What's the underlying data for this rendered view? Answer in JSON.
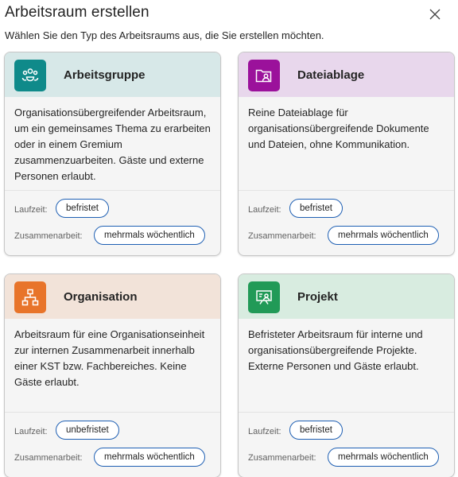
{
  "dialog": {
    "title": "Arbeitsraum erstellen",
    "subtitle": "Wählen Sie den Typ des Arbeitsraums aus, die Sie erstellen möchten."
  },
  "labels": {
    "laufzeit": "Laufzeit:",
    "zusammenarbeit": "Zusammenarbeit:"
  },
  "cards": [
    {
      "title": "Arbeitsgruppe",
      "description": "Organisationsübergreifender Arbeitsraum, um ein gemeinsames Thema zu erarbeiten oder in einem Gremium zusammenzuarbeiten. Gäste und externe Personen erlaubt.",
      "laufzeit": "befristet",
      "zusammenarbeit": "mehrmals wöchentlich",
      "icon": "people-group-icon",
      "header_color": "#d7e8e8",
      "icon_color": "#0f8a8a"
    },
    {
      "title": "Dateiablage",
      "description": "Reine Dateiablage für organisationsübergreifende Dokumente und Dateien, ohne Kommunikation.",
      "laufzeit": "befristet",
      "zusammenarbeit": "mehrmals wöchentlich",
      "icon": "folder-person-icon",
      "header_color": "#e8d7ec",
      "icon_color": "#9b119b"
    },
    {
      "title": "Organisation",
      "description": "Arbeitsraum für eine Organisationseinheit zur internen Zusammenarbeit innerhalb einer KST bzw. Fachbereiches. Keine Gäste erlaubt.",
      "laufzeit": "unbefristet",
      "zusammenarbeit": "mehrmals wöchentlich",
      "icon": "org-chart-icon",
      "header_color": "#f2e3d9",
      "icon_color": "#e8742a"
    },
    {
      "title": "Projekt",
      "description": "Befristeter Arbeitsraum für interne und organisationsübergreifende Projekte. Externe Personen und Gäste erlaubt.",
      "laufzeit": "befristet",
      "zusammenarbeit": "mehrmals wöchentlich",
      "icon": "project-board-icon",
      "header_color": "#d8ece0",
      "icon_color": "#219a57"
    }
  ]
}
